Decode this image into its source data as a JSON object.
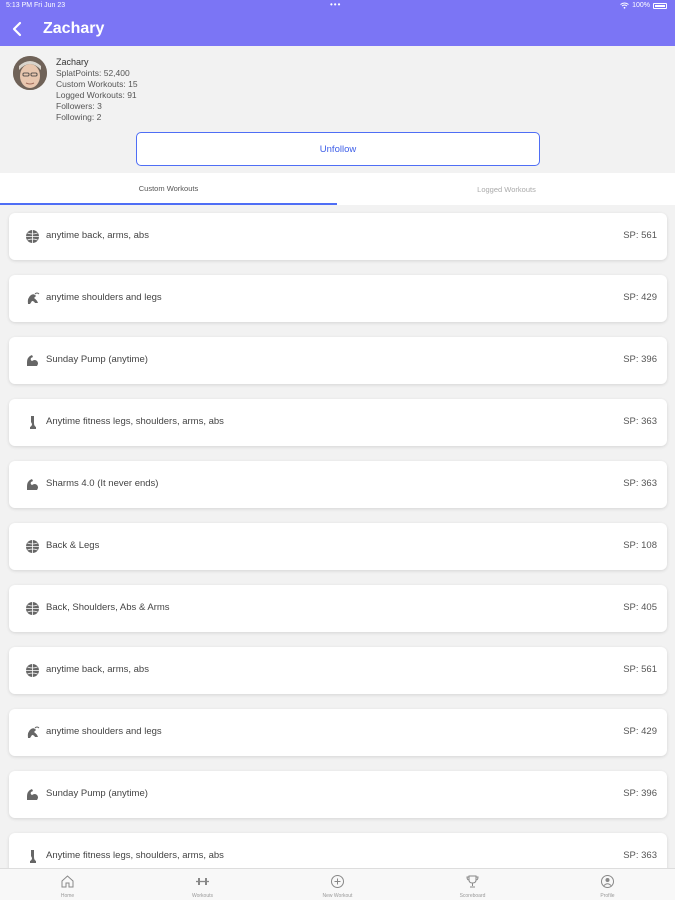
{
  "status_bar": {
    "time": "5:13 PM  Fri Jun 23",
    "dots": "•••",
    "battery": "100%"
  },
  "nav": {
    "title": "Zachary"
  },
  "profile": {
    "name": "Zachary",
    "splat_points": "SplatPoints: 52,400",
    "custom_workouts": "Custom Workouts: 15",
    "logged_workouts": "Logged Workouts: 91",
    "followers": "Followers: 3",
    "following": "Following: 2",
    "button_label": "Unfollow"
  },
  "tabs": [
    {
      "label": "Custom Workouts",
      "active": true
    },
    {
      "label": "Logged Workouts",
      "active": false
    }
  ],
  "workouts": [
    {
      "icon": "globe-icon",
      "title": "anytime back, arms, abs",
      "sp": "SP: 561"
    },
    {
      "icon": "running-icon",
      "title": "anytime shoulders and legs",
      "sp": "SP: 429"
    },
    {
      "icon": "flexed-arm-icon",
      "title": "Sunday Pump (anytime)",
      "sp": "SP: 396"
    },
    {
      "icon": "leg-icon",
      "title": "Anytime fitness legs, shoulders, arms, abs",
      "sp": "SP: 363"
    },
    {
      "icon": "flexed-arm-icon",
      "title": "Sharms 4.0 (It never ends)",
      "sp": "SP: 363"
    },
    {
      "icon": "globe-icon",
      "title": "Back & Legs",
      "sp": "SP: 108"
    },
    {
      "icon": "globe-icon",
      "title": "Back, Shoulders, Abs & Arms",
      "sp": "SP: 405"
    },
    {
      "icon": "globe-icon",
      "title": "anytime back, arms, abs",
      "sp": "SP: 561"
    },
    {
      "icon": "running-icon",
      "title": "anytime shoulders and legs",
      "sp": "SP: 429"
    },
    {
      "icon": "flexed-arm-icon",
      "title": "Sunday Pump (anytime)",
      "sp": "SP: 396"
    },
    {
      "icon": "leg-icon",
      "title": "Anytime fitness legs, shoulders, arms, abs",
      "sp": "SP: 363"
    }
  ],
  "tabbar": [
    {
      "icon": "home-icon",
      "label": "Home"
    },
    {
      "icon": "dumbbell-icon",
      "label": "Workouts"
    },
    {
      "icon": "plus-circle-icon",
      "label": "New Workout"
    },
    {
      "icon": "trophy-icon",
      "label": "Scoreboard"
    },
    {
      "icon": "profile-icon",
      "label": "Profile"
    }
  ],
  "colors": {
    "accent": "#7b75f5",
    "button_border": "#4f6ef5",
    "background": "#f2f2f2"
  }
}
